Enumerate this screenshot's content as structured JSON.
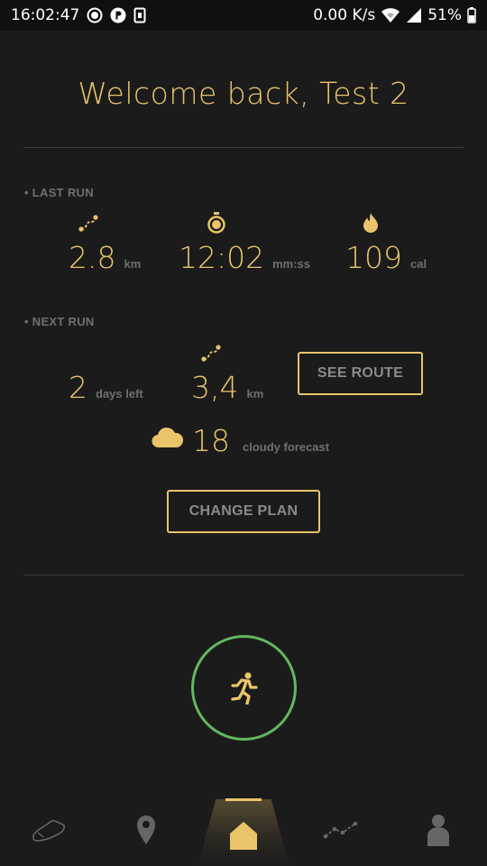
{
  "status_bar": {
    "time": "16:02:47",
    "network_speed": "0.00 K/s",
    "battery": "51%",
    "icons": [
      "record-icon",
      "parking-icon",
      "sim-icon",
      "wifi-icon",
      "signal-icon",
      "battery-icon"
    ]
  },
  "welcome": "Welcome back, Test 2",
  "last_run": {
    "label": "• LAST RUN",
    "distance_value": "2.8",
    "distance_unit": "km",
    "time_value": "12:02",
    "time_unit": "mm:ss",
    "calories_value": "109",
    "calories_unit": "cal",
    "icons": [
      "route-icon",
      "stopwatch-icon",
      "flame-icon"
    ]
  },
  "next_run": {
    "label": "• NEXT RUN",
    "days_value": "2",
    "days_unit": "days left",
    "distance_value": "3,4",
    "distance_unit": "km",
    "see_route_label": "SEE ROUTE",
    "temperature": "18",
    "forecast": "cloudy forecast",
    "icons": [
      "route-icon",
      "cloud-icon"
    ]
  },
  "change_plan_label": "CHANGE PLAN",
  "start_run": {
    "icon": "runner-icon"
  },
  "bottom_nav": {
    "items": [
      "shoe-icon",
      "location-pin-icon",
      "home-icon",
      "trend-icon",
      "profile-icon"
    ],
    "active": "home-icon"
  },
  "colors": {
    "background": "#1b1b1b",
    "accent": "#e9c46a",
    "muted_text": "#6f6f6f",
    "run_circle": "#63b75f"
  }
}
